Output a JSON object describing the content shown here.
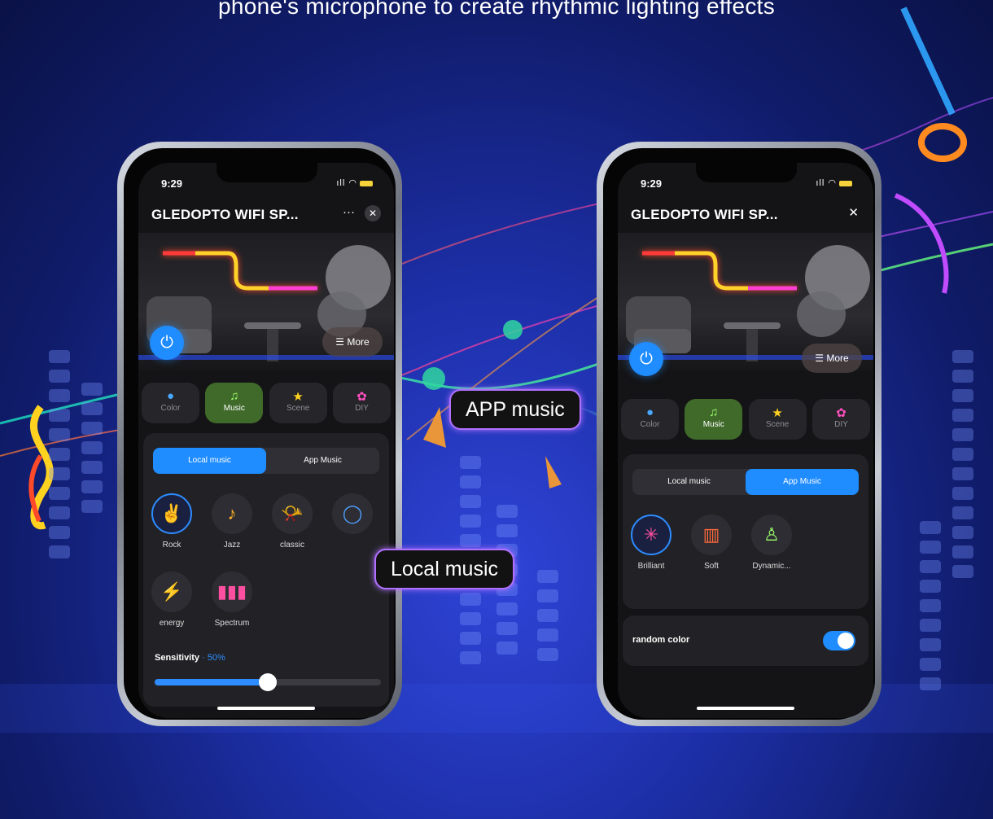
{
  "headline": "phone's microphone to create rhythmic lighting effects",
  "colors": {
    "accent": "#1f8cff",
    "music_tab": "#3f6a2a",
    "callout_border": "#b070ff"
  },
  "callouts": {
    "app": "APP music",
    "local": "Local music"
  },
  "left_phone": {
    "status_time": "9:29",
    "title": "GLEDOPTO WIFI SP...",
    "menu_label": "···",
    "close_label": "✕",
    "more_label": "More",
    "tabs": [
      {
        "label": "Color",
        "icon": "color-icon"
      },
      {
        "label": "Music",
        "icon": "music-icon"
      },
      {
        "label": "Scene",
        "icon": "star-icon"
      },
      {
        "label": "DIY",
        "icon": "palette-icon"
      }
    ],
    "segment": {
      "local": "Local music",
      "app": "App Music",
      "selected": "Local music"
    },
    "effects": [
      {
        "label": "Rock",
        "icon": "rock-icon"
      },
      {
        "label": "Jazz",
        "icon": "harp-icon"
      },
      {
        "label": "classic",
        "icon": "horn-icon"
      },
      {
        "label": "energy",
        "icon": "lightning-icon"
      },
      {
        "label": "Spectrum",
        "icon": "spectrum-icon"
      }
    ],
    "sensitivity_label": "Sensitivity",
    "sensitivity_value": "· 50%",
    "sensitivity_percent": 50
  },
  "right_phone": {
    "status_time": "9:29",
    "title": "GLEDOPTO WIFI SP...",
    "close_label": "✕",
    "more_label": "More",
    "tabs": [
      {
        "label": "Color",
        "icon": "color-icon"
      },
      {
        "label": "Music",
        "icon": "music-icon"
      },
      {
        "label": "Scene",
        "icon": "star-icon"
      },
      {
        "label": "DIY",
        "icon": "palette-icon"
      }
    ],
    "segment": {
      "local": "Local music",
      "app": "App Music",
      "selected": "App Music"
    },
    "effects": [
      {
        "label": "Brilliant",
        "icon": "sparkle-icon"
      },
      {
        "label": "Soft",
        "icon": "soft-icon"
      },
      {
        "label": "Dynamic...",
        "icon": "bell-icon"
      }
    ],
    "random_color_label": "random color",
    "random_color_on": true
  }
}
